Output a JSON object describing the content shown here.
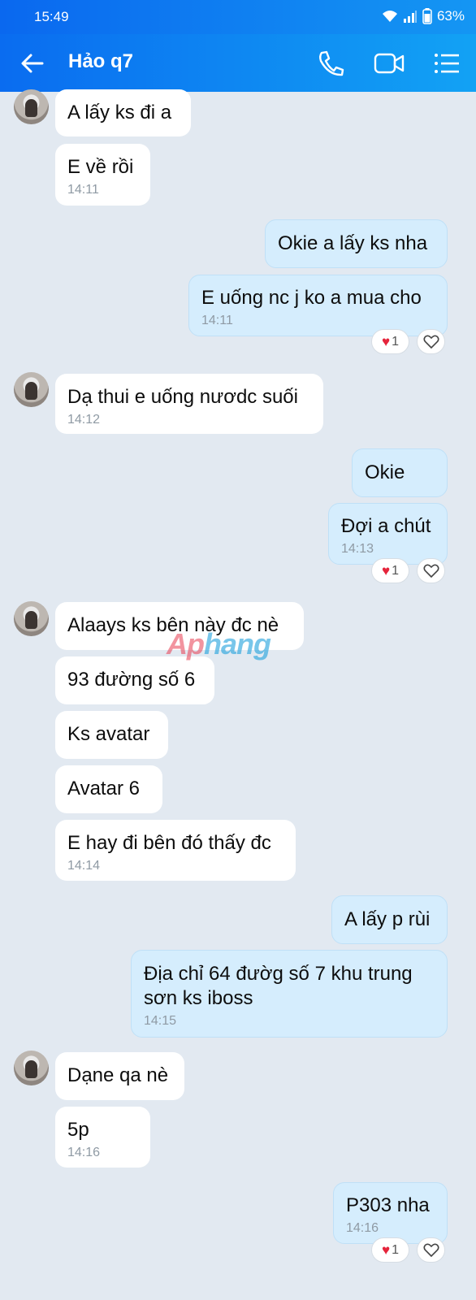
{
  "status": {
    "time": "15:49",
    "battery": "63%"
  },
  "header": {
    "title": "Hảo q7"
  },
  "messages": [
    {
      "text": "A lấy ks đi a"
    },
    {
      "text": "E về rồi",
      "time": "14:11"
    },
    {
      "text": "Okie a lấy ks nha"
    },
    {
      "text": "E uống nc j ko a mua cho",
      "time": "14:11",
      "reaction_count": "1"
    },
    {
      "text": "Dạ thui e uống nươdc suối",
      "time": "14:12"
    },
    {
      "text": "Okie"
    },
    {
      "text": "Đợi a chút",
      "time": "14:13",
      "reaction_count": "1"
    },
    {
      "text": "Alaays ks bên này đc nè"
    },
    {
      "text": "93 đường số 6"
    },
    {
      "text": "Ks avatar"
    },
    {
      "text": "Avatar 6"
    },
    {
      "text": "E hay đi bên đó thấy đc",
      "time": "14:14"
    },
    {
      "text": "A lấy p rùi"
    },
    {
      "text": "Địa chỉ 64 đườg số 7 khu trung\nsơn ks iboss",
      "time": "14:15"
    },
    {
      "text": "Dạne qa nè"
    },
    {
      "text": "5p",
      "time": "14:16"
    },
    {
      "text": "P303 nha",
      "time": "14:16",
      "reaction_count": "1"
    }
  ],
  "watermark": {
    "part1": "Ap",
    "part2": "hang"
  },
  "colors": {
    "header": "#0a6cf0",
    "outgoing_bubble": "#d5edfd",
    "incoming_bubble": "#ffffff",
    "background": "#e2e9f1"
  }
}
